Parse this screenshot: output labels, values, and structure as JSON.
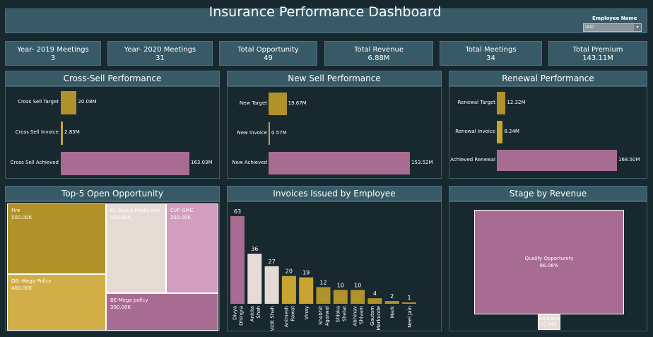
{
  "header": {
    "title": "Insurance Performance Dashboard",
    "employee_filter_label": "Employee Name",
    "employee_filter_value": "(All)"
  },
  "kpis": [
    {
      "label": "Year- 2019 Meetings",
      "value": "3"
    },
    {
      "label": "Year- 2020 Meetings",
      "value": "31"
    },
    {
      "label": "Total Opportunity",
      "value": "49"
    },
    {
      "label": "Total Revenue",
      "value": "6.88M"
    },
    {
      "label": "Total Meetings",
      "value": "34"
    },
    {
      "label": "Total Premium",
      "value": "143.11M"
    }
  ],
  "colors": {
    "target": "#b0922a",
    "invoice": "#c9a432",
    "achieved": "#a86c92",
    "bar_light": "#e6dbd4"
  },
  "chart_data": [
    {
      "type": "bar",
      "title": "Cross-Sell Performance",
      "orientation": "horizontal",
      "categories": [
        "Cross Sell Target",
        "Cross Sell Invoice",
        "Cross Sell Achieved"
      ],
      "values": [
        20.08,
        2.85,
        163.03
      ],
      "value_labels": [
        "20.08M",
        "2.85M",
        "163.03M"
      ]
    },
    {
      "type": "bar",
      "title": "New Sell Performance",
      "orientation": "horizontal",
      "categories": [
        "New Target",
        "New Invoice",
        "New Achieved"
      ],
      "values": [
        19.67,
        0.57,
        153.52
      ],
      "value_labels": [
        "19.67M",
        "0.57M",
        "153.52M"
      ]
    },
    {
      "type": "bar",
      "title": "Renewal Performance",
      "orientation": "horizontal",
      "categories": [
        "Renewal Target",
        "Renewal Invoice",
        "Achieved Renewal"
      ],
      "values": [
        12.32,
        8.24,
        168.5
      ],
      "value_labels": [
        "12.32M",
        "8.24M",
        "168.50M"
      ]
    },
    {
      "type": "treemap",
      "title": "Top-5 Open Opportunity",
      "items": [
        {
          "name": "Fire",
          "value": 500.0,
          "label": "500.00K",
          "color": "#b0922a"
        },
        {
          "name": "DB -Mega Policy",
          "value": 400.0,
          "label": "400.00K",
          "color": "#d1ae48"
        },
        {
          "name": "EL-Group Mediclaim",
          "value": 400.0,
          "label": "400.00K",
          "color": "#e6dbd4"
        },
        {
          "name": "CVP GMC",
          "value": 350.0,
          "label": "350.00K",
          "color": "#d39dc0"
        },
        {
          "name": "BE-Mega policy",
          "value": 300.0,
          "label": "300.00K",
          "color": "#a86c92"
        }
      ]
    },
    {
      "type": "bar",
      "title": "Invoices Issued by Employee",
      "categories": [
        "Divya Dhingra",
        "Ankita Shah",
        "Vidit Shah",
        "Animesh Rawat",
        "Vinay",
        "Shobhit Agarwal",
        "Shloka Shelat",
        "Abhinav Shivam",
        "Gautam Markunde",
        "Mark",
        "Neel Jain"
      ],
      "category_lines": [
        [
          "Divya",
          "Dhingra"
        ],
        [
          "Ankita",
          "Shah"
        ],
        [
          "Vidit Shah"
        ],
        [
          "Animesh",
          "Rawat"
        ],
        [
          "Vinay"
        ],
        [
          "Shobhit",
          "Agarwal"
        ],
        [
          "Shloka",
          "Shelat"
        ],
        [
          "Abhinav",
          "Shivam"
        ],
        [
          "Gautam",
          "Markunde"
        ],
        [
          "Mark"
        ],
        [
          "Neel Jain"
        ]
      ],
      "values": [
        63,
        36,
        27,
        20,
        19,
        12,
        10,
        10,
        4,
        2,
        1
      ],
      "colors": [
        "#a86c92",
        "#e6dbd4",
        "#e6dbd4",
        "#c9a432",
        "#c9a432",
        "#b0922a",
        "#b0922a",
        "#b0922a",
        "#b0922a",
        "#b0922a",
        "#b0922a"
      ]
    },
    {
      "type": "treemap",
      "title": "Stage by Revenue",
      "items": [
        {
          "name": "Qualify Opportunity",
          "value": 86.06,
          "label": "86.06%",
          "color": "#a86c92"
        },
        {
          "name": "Negotiation",
          "value": 13.94,
          "label": "13.94%",
          "color": "#e6dbd4"
        }
      ]
    }
  ]
}
